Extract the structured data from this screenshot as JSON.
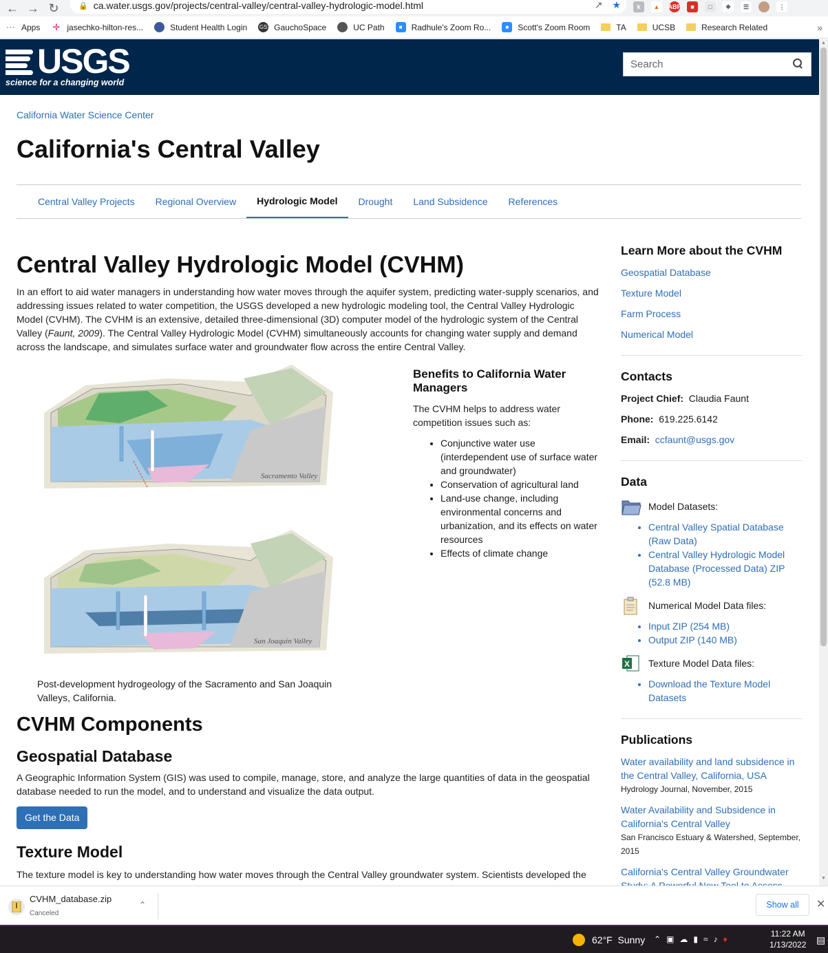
{
  "browser": {
    "url": "ca.water.usgs.gov/projects/central-valley/central-valley-hydrologic-model.html",
    "bookmarks": [
      {
        "label": "Apps"
      },
      {
        "label": "jasechko-hilton-res..."
      },
      {
        "label": "Student Health Login"
      },
      {
        "label": "GauchoSpace"
      },
      {
        "label": "UC Path"
      },
      {
        "label": "Radhule's Zoom Ro..."
      },
      {
        "label": "Scott's Zoom Room"
      },
      {
        "label": "TA"
      },
      {
        "label": "UCSB"
      },
      {
        "label": "Research Related"
      }
    ]
  },
  "header": {
    "logo_text": "USGS",
    "logo_tagline": "science for a changing world",
    "search_placeholder": "Search"
  },
  "breadcrumb": "California Water Science Center",
  "site_title": "California's Central Valley",
  "tabs": [
    {
      "label": "Central Valley Projects"
    },
    {
      "label": "Regional Overview"
    },
    {
      "label": "Hydrologic Model",
      "active": true
    },
    {
      "label": "Drought"
    },
    {
      "label": "Land Subsidence"
    },
    {
      "label": "References"
    }
  ],
  "main": {
    "title": "Central Valley Hydrologic Model (CVHM)",
    "intro_before": "In an effort to aid water managers in understanding how water moves through the aquifer system, predicting water-supply scenarios, and addressing issues related to water competition, the USGS developed a new hydrologic modeling tool, the Central Valley Hydrologic Model (CVHM). The CVHM is an extensive, detailed three-dimensional (3D) computer model of the hydrologic system of the Central Valley (",
    "intro_cite": "Faunt, 2009",
    "intro_after": "). The Central Valley Hydrologic Model (CVHM) simultaneously accounts for changing water supply and demand across the landscape, and simulates surface water and groundwater flow across the entire Central Valley.",
    "diagram_labels": [
      "Sacramento Valley",
      "San Joaquin Valley"
    ],
    "caption": "Post-development hydrogeology of the Sacramento and San Joaquin Valleys, California.",
    "benefits": {
      "title": "Benefits to California Water Managers",
      "intro": "The CVHM helps to address water competition issues such as:",
      "items": [
        "Conjunctive water use (interdependent use of surface water and groundwater)",
        "Conservation of agricultural land",
        "Land-use change, including environmental concerns and urbanization, and its effects on water resources",
        "Effects of climate change"
      ]
    },
    "components_title": "CVHM Components",
    "geospatial_title": "Geospatial Database",
    "geospatial_text": "A Geographic Information System (GIS) was used to compile, manage, store, and analyze the large quantities of data in the geospatial database needed to run the model, and to understand and visualize the data output.",
    "get_data_label": "Get the Data",
    "texture_title": "Texture Model",
    "texture_text": "The texture model is key to understanding how water moves through the Central Valley groundwater system. Scientists developed the"
  },
  "sidebar": {
    "learn_title": "Learn More about the CVHM",
    "learn_links": [
      "Geospatial Database",
      "Texture Model",
      "Farm Process",
      "Numerical Model"
    ],
    "contacts_title": "Contacts",
    "project_chief_label": "Project Chief:",
    "project_chief": "Claudia Faunt",
    "phone_label": "Phone:",
    "phone": "619.225.6142",
    "email_label": "Email:",
    "email": "ccfaunt@usgs.gov",
    "data_title": "Data",
    "model_datasets_label": "Model Datasets:",
    "model_datasets": [
      "Central Valley Spatial Database (Raw Data)",
      "Central Valley Hydrologic Model Database (Processed Data) ZIP (52.8 MB)"
    ],
    "numerical_label": "Numerical Model Data files:",
    "numerical_files": [
      "Input ZIP (254 MB)",
      "Output ZIP (140 MB)"
    ],
    "texture_label": "Texture Model Data files:",
    "texture_files": [
      "Download the Texture Model Datasets"
    ],
    "publications_title": "Publications",
    "publications": [
      {
        "title": "Water availability and land subsidence in the Central Valley, California, USA",
        "meta": "Hydrology Journal, November, 2015"
      },
      {
        "title": "Water Availability and Subsidence in California's Central Valley",
        "meta": "San Francisco Estuary & Watershed, September, 2015"
      },
      {
        "title": "California's Central Valley Groundwater Study: A Powerful New Tool to Assess Water Resources in California's Central",
        "meta": ""
      }
    ]
  },
  "download": {
    "filename": "CVHM_database.zip",
    "status": "Canceled",
    "show_all": "Show all"
  },
  "taskbar": {
    "temperature": "62°F",
    "weather": "Sunny",
    "time": "11:22 AM",
    "date": "1/13/2022"
  }
}
